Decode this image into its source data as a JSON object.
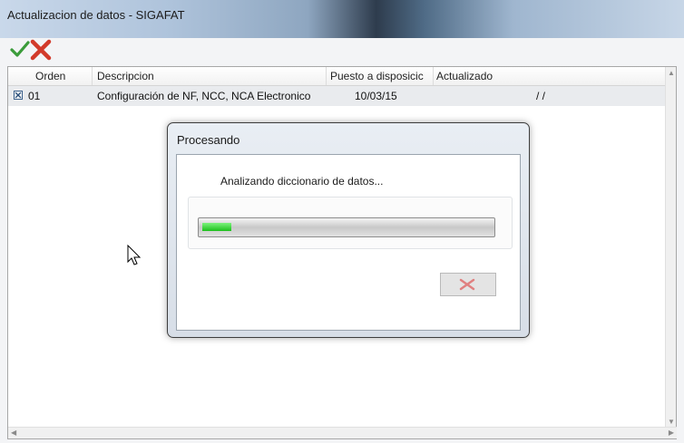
{
  "window": {
    "title": "Actualizacion de datos - SIGAFAT"
  },
  "toolbar": {
    "accept_icon": "check-icon",
    "cancel_icon": "close-icon",
    "accept_color": "#3a9b3a",
    "cancel_color": "#d23a2a"
  },
  "grid": {
    "columns": [
      "Orden",
      "Descripcion",
      "Puesto a disposicic",
      "Actualizado"
    ],
    "rows": [
      {
        "checked": true,
        "orden": "01",
        "descripcion": "Configuración  de NF, NCC, NCA Electronico",
        "puesto": "10/03/15",
        "actualizado": "/ /"
      }
    ]
  },
  "dialog": {
    "title": "Procesando",
    "message": "Analizando diccionario de datos...",
    "progress": 0.1,
    "progress_color": "#22c322"
  }
}
